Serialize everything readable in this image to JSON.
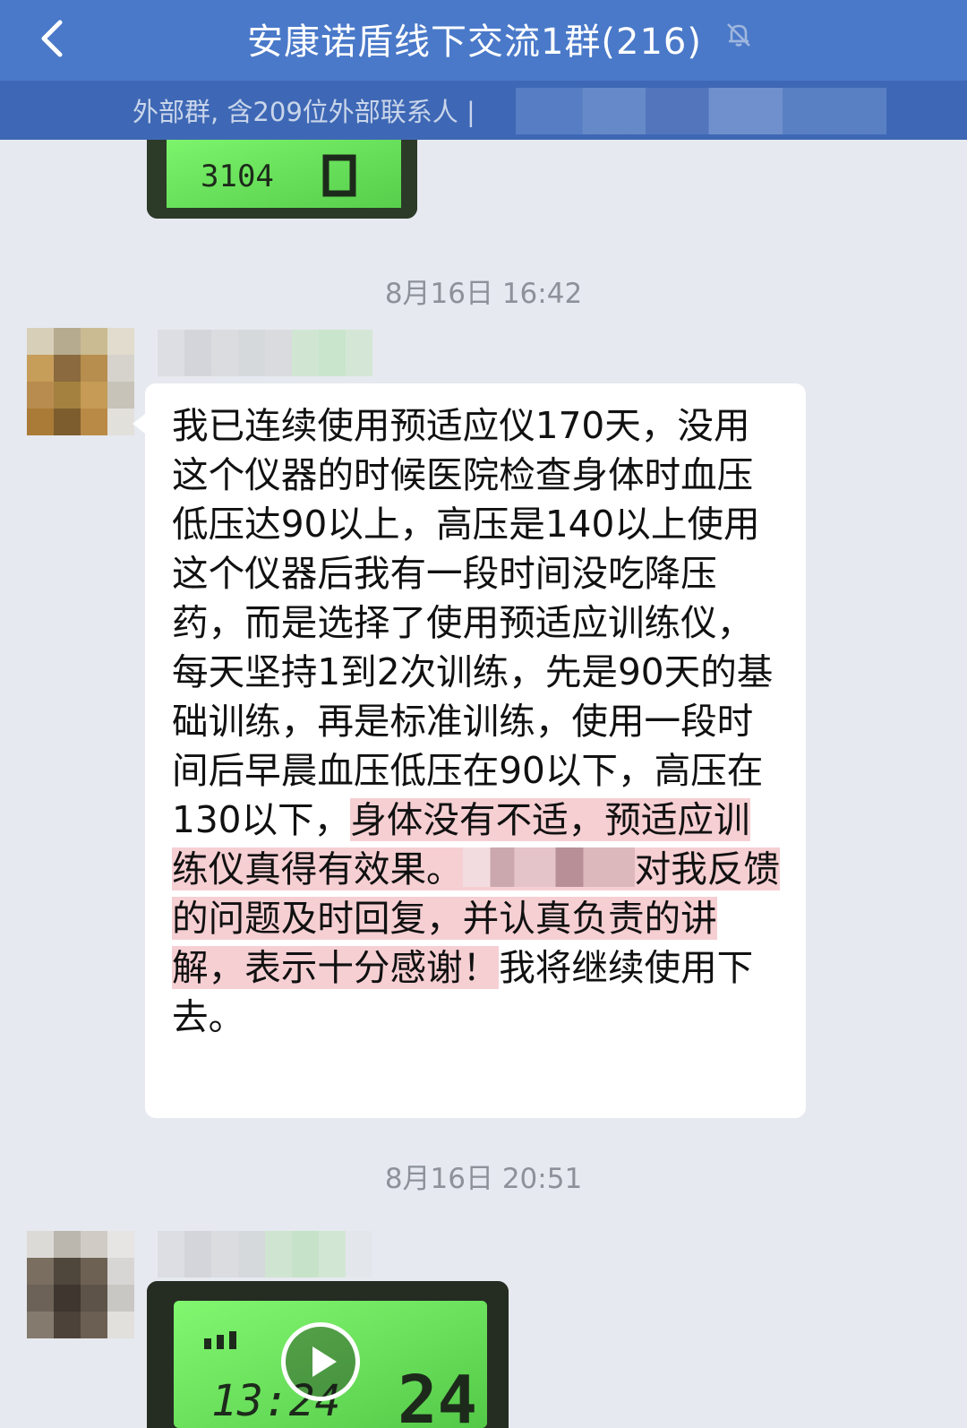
{
  "header": {
    "title": "安康诺盾线下交流1群(216)",
    "back_icon": "chevron-left-icon",
    "mute_icon": "bell-off-icon",
    "subtitle": "外部群, 含209位外部联系人 |"
  },
  "messages": {
    "timestamp_1": "8月16日 16:42",
    "timestamp_2": "8月16日 20:51",
    "text": {
      "part_1": "我已连续使用预适应仪170天，没用这个仪器的时候医院检查身体时血压低压达90以上，高压是140以上使用这个仪器后我有一段时间没吃降压药，而是选择了使用预适应训练仪，每天坚持1到2次训练，先是90天的基础训练，再是标准训练，使用一段时间后早晨血压低压在90以下，高压在130以下，",
      "highlight_1": "身体没有不适，预适应训练仪真得有效果。",
      "highlight_2": "对我反馈的问题及时回复，并认真负责的讲解，表示十分感谢！",
      "part_2": "我将继续使用下去。"
    }
  },
  "colors": {
    "header_bg": "#4a79c9",
    "subbar_bg": "#3e68b5",
    "chat_bg": "#e6e9ef",
    "highlight": "#f6cfd3",
    "screen_green": "#6ef25f"
  },
  "media": {
    "thumb_1": {
      "display_digits": "3104"
    },
    "video_1": {
      "display_time": "13:24",
      "display_digits": "24"
    }
  }
}
